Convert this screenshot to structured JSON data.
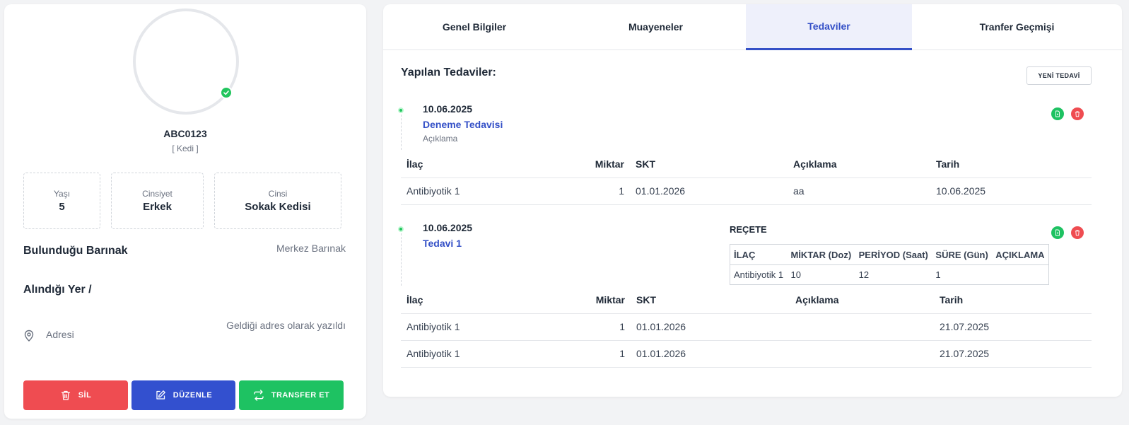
{
  "pet": {
    "code": "ABC0123",
    "type": "[ Kedi ]",
    "age_label": "Yaşı",
    "age": "5",
    "gender_label": "Cinsiyet",
    "gender": "Erkek",
    "breed_label": "Cinsi",
    "breed": "Sokak Kedisi"
  },
  "shelter": {
    "label": "Bulunduğu Barınak",
    "value": "Merkez Barınak"
  },
  "origin": {
    "label": "Alındığı Yer /"
  },
  "address": {
    "label": "Adresi",
    "value": "Geldiği adres olarak yazıldı"
  },
  "actions": {
    "delete": "SİL",
    "edit": "DÜZENLE",
    "transfer": "TRANSFER ET"
  },
  "tabs": [
    {
      "label": "Genel Bilgiler",
      "active": false
    },
    {
      "label": "Muayeneler",
      "active": false
    },
    {
      "label": "Tedaviler",
      "active": true
    },
    {
      "label": "Tranfer Geçmişi",
      "active": false
    }
  ],
  "treatments_section": {
    "title": "Yapılan Tedaviler:",
    "new_button": "YENİ TEDAVİ"
  },
  "med_headers": {
    "drug": "İlaç",
    "qty": "Miktar",
    "skt": "SKT",
    "desc": "Açıklama",
    "date": "Tarih"
  },
  "treatments": [
    {
      "date": "10.06.2025",
      "name": "Deneme Tedavisi",
      "description": "Açıklama",
      "rows": [
        {
          "drug": "Antibiyotik 1",
          "qty": "1",
          "skt": "01.01.2026",
          "desc": "aa",
          "date": "10.06.2025"
        }
      ]
    },
    {
      "date": "10.06.2025",
      "name": "Tedavi 1",
      "prescription": {
        "title": "REÇETE",
        "headers": {
          "drug": "İLAÇ",
          "qty": "MİKTAR (Doz)",
          "period": "PERİYOD (Saat)",
          "duration": "SÜRE (Gün)",
          "desc": "AÇIKLAMA"
        },
        "rows": [
          {
            "drug": "Antibiyotik 1",
            "qty": "10",
            "period": "12",
            "duration": "1",
            "desc": ""
          }
        ]
      },
      "rows": [
        {
          "drug": "Antibiyotik 1",
          "qty": "1",
          "skt": "01.01.2026",
          "desc": "",
          "date": "21.07.2025"
        },
        {
          "drug": "Antibiyotik 1",
          "qty": "1",
          "skt": "01.01.2026",
          "desc": "",
          "date": "21.07.2025"
        }
      ]
    }
  ],
  "colors": {
    "primary": "#3450c7",
    "danger": "#ef4c51",
    "success": "#1ec262",
    "muted": "#6b7280"
  }
}
